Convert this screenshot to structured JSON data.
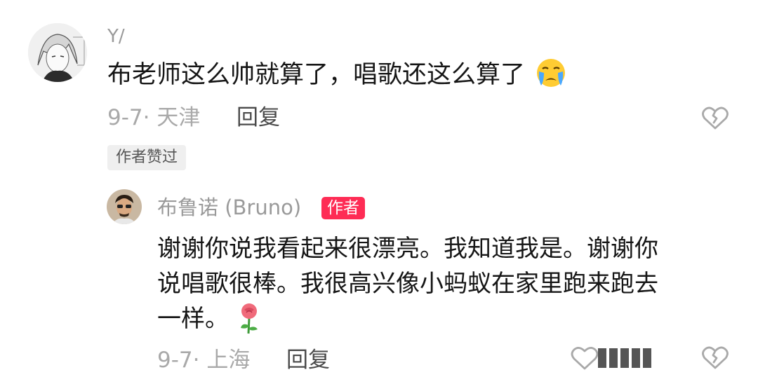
{
  "top_comment": {
    "username": "Y/",
    "text": "布老师这么帅就算了，唱歌还这么算了",
    "emoji": "crying-face-icon",
    "date": "9-7",
    "location": "天津",
    "reply_label": "回复",
    "liked_badge": "作者赞过",
    "dislike_icon": "broken-heart-icon"
  },
  "reply": {
    "username": "布鲁诺 (Bruno)",
    "author_badge": "作者",
    "text_line1": "谢谢你说我看起来很漂亮。我知道我是。谢谢你",
    "text_line2": "说唱歌很棒。我很高兴像小蚂蚁在家里跑来跑去",
    "text_line3": "一样。",
    "emoji": "rose-icon",
    "date": "9-7",
    "location": "上海",
    "reply_label": "回复",
    "like_icon": "heart-icon",
    "dislike_icon": "broken-heart-icon"
  },
  "colors": {
    "author_badge_bg": "#fe2c55",
    "meta_text": "#a9a9a9",
    "primary_text": "#161616"
  }
}
